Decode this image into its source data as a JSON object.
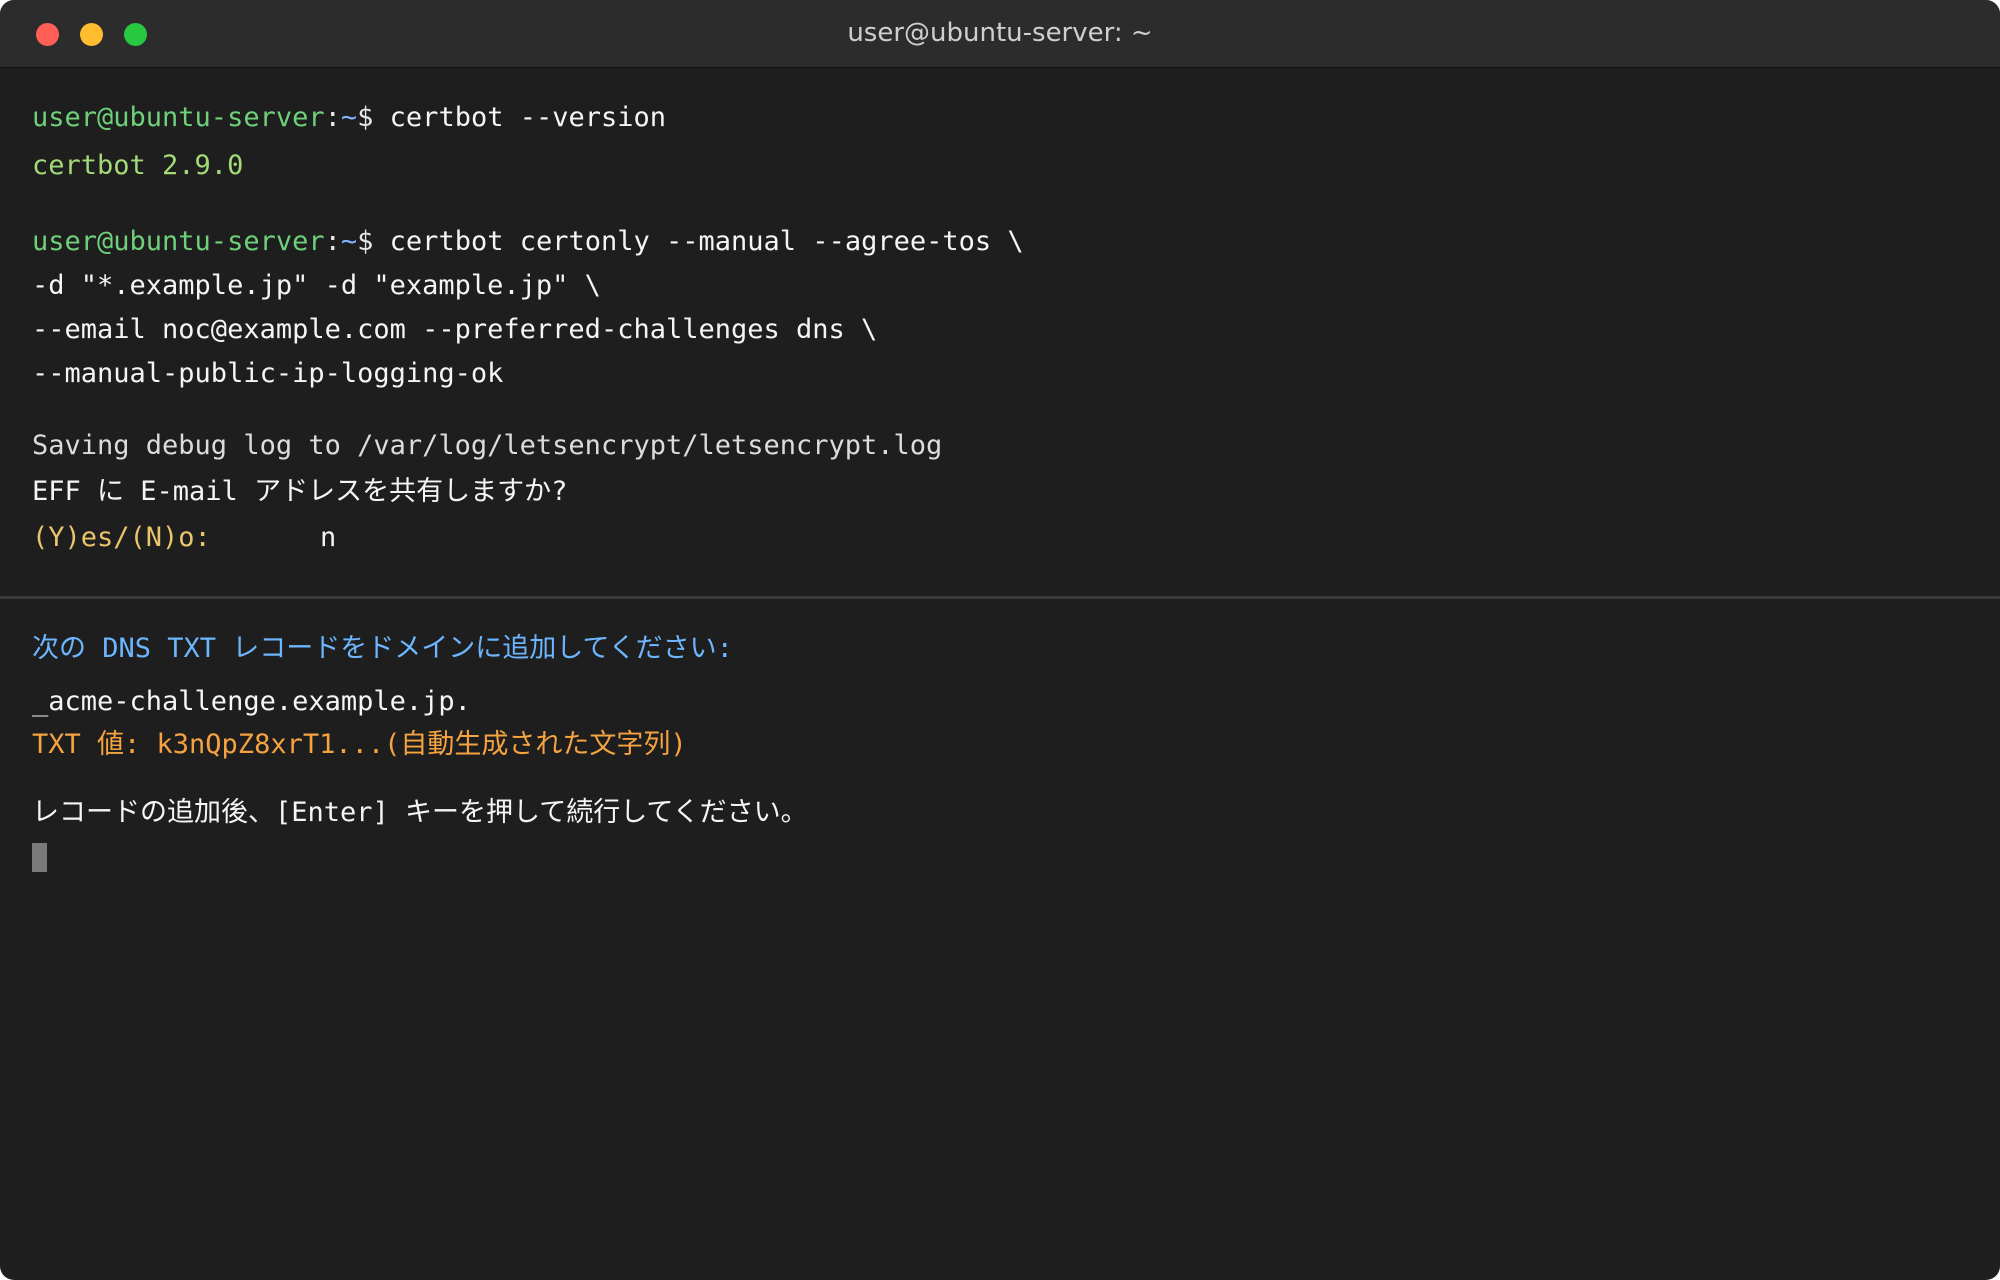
{
  "window": {
    "title": "user@ubuntu-server: ~"
  },
  "prompt": {
    "user_host": "user@ubuntu-server",
    "separator": ":",
    "path": "~",
    "dollar": "$"
  },
  "terminal": {
    "cmd1": "certbot --version",
    "out1": "certbot 2.9.0",
    "cmd2_line1": "certbot certonly --manual --agree-tos \\",
    "cmd2_line2": "-d \"*.example.jp\" -d \"example.jp\" \\",
    "cmd2_line3": "--email noc@example.com --preferred-challenges dns \\",
    "cmd2_line4": "--manual-public-ip-logging-ok",
    "log_line": "Saving debug log to /var/log/letsencrypt/letsencrypt.log",
    "eff_question": "EFF に E-mail アドレスを共有しますか?",
    "yes_no_prompt": "(Y)es/(N)o:",
    "yes_no_answer": "n",
    "dns_instruction": "次の DNS TXT レコードをドメインに追加してください:",
    "record_name": "_acme-challenge.example.jp.",
    "txt_value": "TXT 値: k3nQpZ8xrT1...(自動生成された文字列)",
    "continue_prompt": "レコードの追加後、[Enter] キーを押して続行してください。"
  },
  "colors": {
    "prompt_user": "#6fd07a",
    "prompt_path": "#7fb4ff",
    "version_output": "#a3d977",
    "yes_no_prompt": "#e9c46a",
    "dns_instruction": "#6cb6ff",
    "txt_value": "#f4a340",
    "background": "#1e1e1e"
  }
}
